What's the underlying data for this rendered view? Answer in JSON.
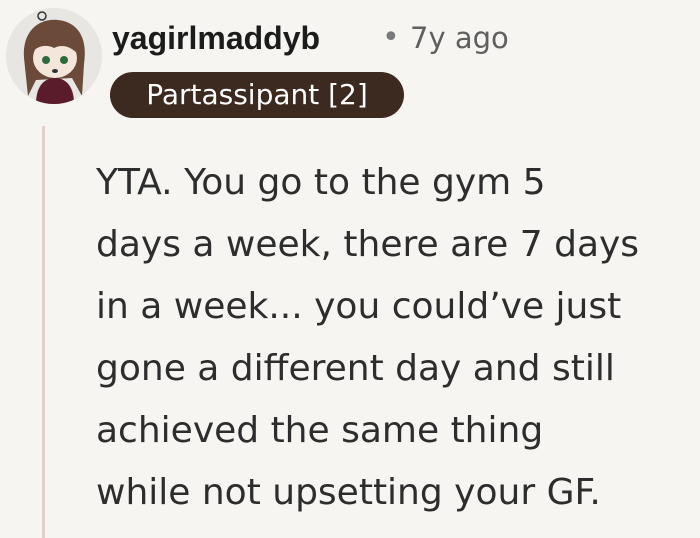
{
  "comment": {
    "avatar_icon": "user-avatar-icon",
    "username": "yagirlmaddyb",
    "separator": "•",
    "timestamp": "7y ago",
    "flair": "Partassipant [2]",
    "body": "YTA. You go to the gym 5\ndays a week, there are 7 days\nin a week... you could’ve just\ngone a different day and still\nachieved the same thing\nwhile not upsetting your GF."
  },
  "colors": {
    "background": "#f6f5f2",
    "flair_bg": "#3c2a21",
    "thread_line": "#e4cfc7",
    "text": "#2d2d2d"
  }
}
